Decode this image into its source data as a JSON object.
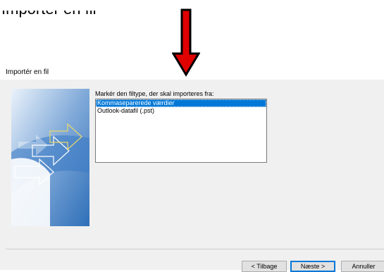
{
  "top_caption": "Importér en fil",
  "dialog": {
    "title": "Importér en fil",
    "instruction": "Markér den filtype, der skal importeres fra:",
    "file_types": [
      {
        "label": "Kommaseparerede værdier",
        "selected": true
      },
      {
        "label": "Outlook-datafil (.pst)",
        "selected": false
      }
    ],
    "buttons": {
      "back": "< Tilbage",
      "next": "Næste >",
      "cancel": "Annuller"
    }
  },
  "colors": {
    "selection": "#0078d7",
    "arrow": "#e00000",
    "dialog_bg": "#f0f0f0"
  },
  "icons": {
    "pointer_arrow": "down-arrow-icon",
    "wizard_image": "import-export-wizard-graphic"
  }
}
